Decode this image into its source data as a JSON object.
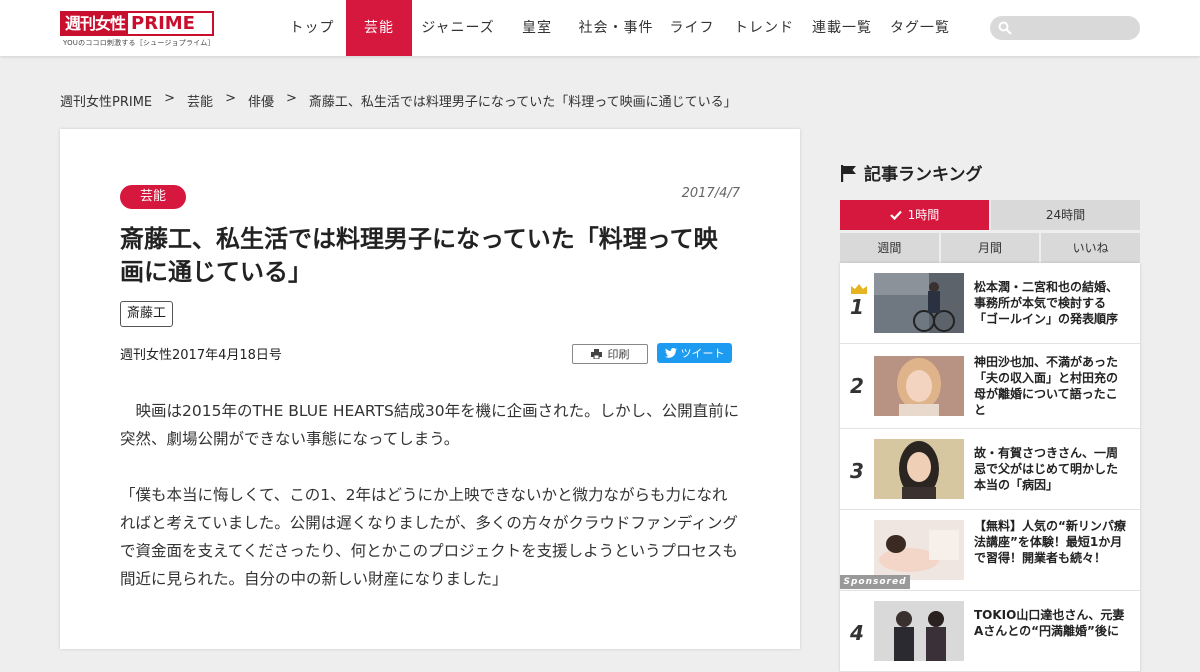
{
  "header": {
    "logo_jp": "週刊女性",
    "logo_en": "PRIME",
    "logo_sub": "YOUのココロ刺激する［シュージョプライム］",
    "nav": [
      {
        "label": "トップ",
        "active": false
      },
      {
        "label": "芸能",
        "active": true
      },
      {
        "label": "ジャニーズ",
        "active": false
      },
      {
        "label": "皇室",
        "active": false
      },
      {
        "label": "社会・事件",
        "active": false
      },
      {
        "label": "ライフ",
        "active": false
      },
      {
        "label": "トレンド",
        "active": false
      },
      {
        "label": "連載一覧",
        "active": false
      },
      {
        "label": "タグ一覧",
        "active": false
      }
    ],
    "search_placeholder": ""
  },
  "breadcrumb": {
    "items": [
      "週刊女性PRIME",
      "芸能",
      "俳優",
      "斎藤工、私生活では料理男子になっていた「料理って映画に通じている」"
    ],
    "separator": ">"
  },
  "article": {
    "category": "芸能",
    "date": "2017/4/7",
    "title": "斎藤工、私生活では料理男子になっていた「料理って映画に通じている」",
    "tag": "斎藤工",
    "source": "週刊女性2017年4月18日号",
    "print_label": "印刷",
    "tweet_label": "ツイート",
    "paragraphs": [
      "　映画は2015年のTHE BLUE HEARTS結成30年を機に企画された。しかし、公開直前に突然、劇場公開ができない事態になってしまう。",
      "「僕も本当に悔しくて、この1、2年はどうにか上映できないかと微力ながらも力になれればと考えていました。公開は遅くなりましたが、多くの方々がクラウドファンディングで資金面を支えてくださったり、何とかこのプロジェクトを支援しようというプロセスも間近に見られた。自分の中の新しい財産になりました」"
    ]
  },
  "sidebar": {
    "heading": "記事ランキング",
    "tabs_row1": [
      {
        "label": "1時間",
        "active": true
      },
      {
        "label": "24時間",
        "active": false
      }
    ],
    "tabs_row2": [
      {
        "label": "週間"
      },
      {
        "label": "月間"
      },
      {
        "label": "いいね"
      }
    ],
    "ranking": [
      {
        "rank": "1",
        "text": "松本潤・二宮和也の結婚、事務所が本気で検討する「ゴールイン」の発表順序",
        "sponsored": false
      },
      {
        "rank": "2",
        "text": "神田沙也加、不満があった「夫の収入面」と村田充の母が離婚について語ったこと",
        "sponsored": false
      },
      {
        "rank": "3",
        "text": "故・有賀さつきさん、一周忌で父がはじめて明かした本当の「病因」",
        "sponsored": false
      },
      {
        "rank": "",
        "text": "【無料】人気の“新リンパ療法講座”を体験！最短1か月で習得！開業者も続々！",
        "sponsored": true,
        "sponsored_label": "Sponsored"
      },
      {
        "rank": "4",
        "text": "TOKIO山口達也さん、元妻Aさんとの“円満離婚”後に",
        "sponsored": false
      }
    ]
  },
  "colors": {
    "accent": "#d6173e",
    "twitter": "#1d9bf0"
  }
}
